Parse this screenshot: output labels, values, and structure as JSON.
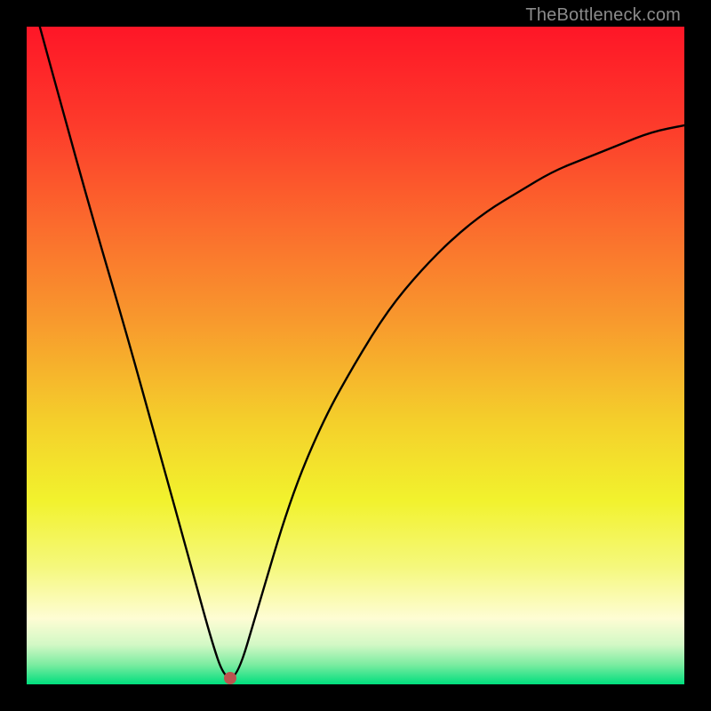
{
  "watermark": "TheBottleneck.com",
  "colors": {
    "frame": "#000000",
    "gradient_stops": [
      {
        "offset": 0.0,
        "color": "#fe1627"
      },
      {
        "offset": 0.15,
        "color": "#fd3b2b"
      },
      {
        "offset": 0.3,
        "color": "#fb6b2d"
      },
      {
        "offset": 0.45,
        "color": "#f89a2d"
      },
      {
        "offset": 0.6,
        "color": "#f4cf2b"
      },
      {
        "offset": 0.72,
        "color": "#f2f22d"
      },
      {
        "offset": 0.82,
        "color": "#f5f87b"
      },
      {
        "offset": 0.9,
        "color": "#fefdd4"
      },
      {
        "offset": 0.94,
        "color": "#d2f8c5"
      },
      {
        "offset": 0.97,
        "color": "#7ceca1"
      },
      {
        "offset": 1.0,
        "color": "#00de7d"
      }
    ],
    "curve": "#000000",
    "dot": "#bc534f"
  },
  "chart_data": {
    "type": "line",
    "title": "",
    "xlabel": "",
    "ylabel": "",
    "xlim": [
      0,
      100
    ],
    "ylim": [
      0,
      100
    ],
    "series": [
      {
        "name": "bottleneck-curve",
        "x": [
          2,
          5,
          10,
          15,
          20,
          25,
          28,
          30,
          32,
          35,
          40,
          45,
          50,
          55,
          60,
          65,
          70,
          75,
          80,
          85,
          90,
          95,
          100
        ],
        "y": [
          100,
          89,
          71,
          54,
          36,
          18,
          7,
          1,
          1,
          11,
          28,
          40,
          49,
          57,
          63,
          68,
          72,
          75,
          78,
          80,
          82,
          84,
          85
        ]
      }
    ],
    "marker": {
      "x": 31,
      "y": 1
    },
    "notes": "V-shaped bottleneck curve over a vertical heat gradient. Minimum (ideal match) at roughly x=31. No visible axis ticks or numeric labels; values are estimated from curve shape relative to plot bounds."
  }
}
